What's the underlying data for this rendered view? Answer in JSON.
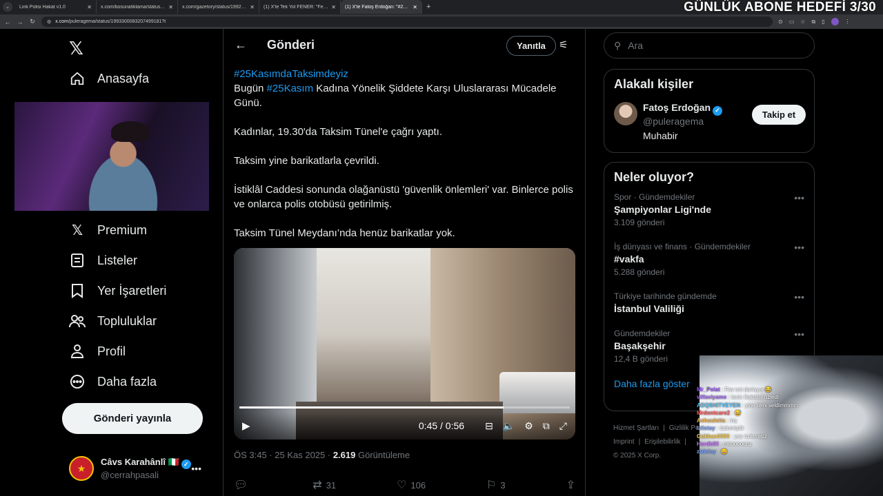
{
  "browser": {
    "tabs": [
      {
        "label": "Link Polisi Hakat v1.0",
        "active": false
      },
      {
        "label": "x.com/bosunatiklama/status/1...",
        "active": false
      },
      {
        "label": "x.com/gazetory/status/199273...",
        "active": false
      },
      {
        "label": "(1) X'te Tek Yol FENER: \"Fenerli...",
        "active": false
      },
      {
        "label": "(1) X'te Fatoş Erdoğan: \"#25Ka...",
        "active": true
      }
    ],
    "url_domain": "x.com",
    "url_path": "/puleragema/status/1993300083207499181?t"
  },
  "stream_overlay": {
    "title": "GÜNLÜK ABONE HEDEFİ 3/30"
  },
  "sidebar": {
    "items": [
      {
        "label": "Anasayfa",
        "icon": "home-icon"
      },
      {
        "label": "Premium",
        "icon": "x-logo-icon"
      },
      {
        "label": "Listeler",
        "icon": "list-icon"
      },
      {
        "label": "Yer İşaretleri",
        "icon": "bookmark-icon"
      },
      {
        "label": "Topluluklar",
        "icon": "communities-icon"
      },
      {
        "label": "Profil",
        "icon": "profile-icon"
      },
      {
        "label": "Daha fazla",
        "icon": "more-circle-icon"
      }
    ],
    "post_button": "Gönderi yayınla",
    "account": {
      "name": "Câvs Karahânlî 🇮🇹",
      "handle": "@cerrahpasali"
    }
  },
  "post": {
    "header_title": "Gönderi",
    "reply_button": "Yanıtla",
    "hashtag_line": "#25KasımdaTaksimdeyiz",
    "p1_before": "Bugün ",
    "p1_link": "#25Kasım",
    "p1_after": " Kadına Yönelik Şiddete Karşı Uluslararası Mücadele Günü.",
    "p2": "Kadınlar, 19.30'da Taksim Tünel'e çağrı yaptı.",
    "p3": "Taksim yine barikatlarla çevrildi.",
    "p4": "İstiklâl Caddesi sonunda  olağanüstü 'güvenlik önlemleri' var. Binlerce polis ve onlarca polis otobüsü getirilmiş.",
    "p5": "Taksim Tünel Meydanı’nda henüz barikatlar yok.",
    "video": {
      "time": "0:45 / 0:56",
      "progress": 0.8
    },
    "time": "ÖS 3:45 · 25 Kas 2025 · ",
    "views": "2.619",
    "views_label": " Görüntüleme",
    "stats": {
      "replies": "",
      "reposts": "31",
      "likes": "106",
      "bookmarks": "3"
    }
  },
  "right": {
    "search_placeholder": "Ara",
    "related_title": "Alakalı kişiler",
    "person": {
      "name": "Fatoş Erdoğan",
      "handle": "@puleragema",
      "bio": "Muhabir",
      "follow": "Takip et"
    },
    "trends_title": "Neler oluyor?",
    "trends": [
      {
        "category": "Spor · Gündemdekiler",
        "title": "Şampiyonlar Ligi'nde",
        "count": "3.109 gönderi"
      },
      {
        "category": "İş dünyası ve finans · Gündemdekiler",
        "title": "#vakfa",
        "count": "5.288 gönderi"
      },
      {
        "category": "Türkiye tarihinde gündemde",
        "title": "İstanbul Valiliği",
        "count": ""
      },
      {
        "category": "Gündemdekiler",
        "title": "Başakşehir",
        "count": "12,4 B gönderi"
      }
    ],
    "show_more": "Daha fazla göster",
    "footer": [
      "Hizmet Şartları",
      "Gizlilik Po",
      "Imprint",
      "Erişilebilirlik",
      "© 2025 X Corp."
    ]
  },
  "chat": [
    {
      "user": "Mr_Polat",
      "msg": "Fav exi darlayıs 😂",
      "color": "#9b59ff"
    },
    {
      "user": "vilfaviyame",
      "msg": "toxic ilişkisini özledi",
      "color": "#a86bff"
    },
    {
      "user": "ADQSHITVEYEN",
      "msg": "yine beni seldimmmm",
      "color": "#4cc3ff"
    },
    {
      "user": "Mrdontcare2",
      "msg": "😅",
      "color": "#ff5b5b"
    },
    {
      "user": "Ashuuletta",
      "msg": "inş",
      "color": "#ffb84c"
    },
    {
      "user": "Izlistay",
      "msg": "özlemiştik",
      "color": "#7aa2ff"
    },
    {
      "user": "Gokhan0996",
      "msg": "yaz özlemişiz",
      "color": "#ffd24c"
    },
    {
      "user": "Hardb8ll",
      "msg": "mitooooonz",
      "color": "#c97bff"
    },
    {
      "user": "zizlelay",
      "msg": "😄",
      "color": "#7aa2ff"
    }
  ]
}
